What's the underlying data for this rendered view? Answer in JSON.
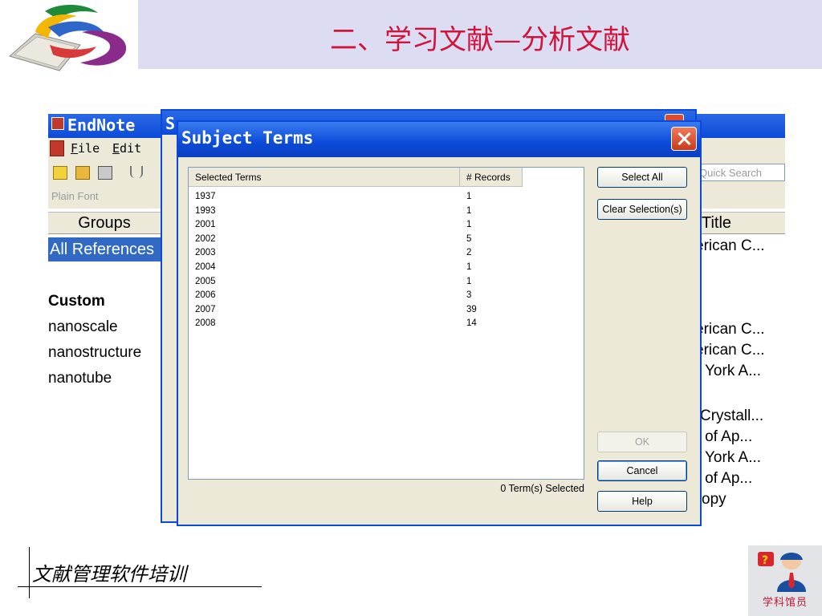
{
  "slide": {
    "title": "二、学习文献—分析文献",
    "footer_text": "文献管理软件培训",
    "badge_text": "学科馆员"
  },
  "endnote_window": {
    "title": "EndNote",
    "menu": [
      "File",
      "Edit"
    ],
    "font_selector": "Plain Font",
    "quick_search_placeholder": "Quick Search",
    "groups_header": "Groups",
    "selected_group": "All References",
    "custom_group_header": "Custom",
    "custom_groups": [
      "nanoscale",
      "nanostructure",
      "nanotube"
    ],
    "title_column_header": "Title",
    "visible_titles": [
      "erican C...",
      "erican C...",
      "erican C...",
      "York A...",
      "Crystall...",
      "al of Ap...",
      "York A...",
      "al of Ap...",
      "opy"
    ]
  },
  "background_dialog": {
    "title_letter": "S"
  },
  "dialog": {
    "title": "Subject Terms",
    "columns": [
      "Selected Terms",
      "# Records"
    ],
    "rows": [
      {
        "term": "1937",
        "records": "1"
      },
      {
        "term": "1993",
        "records": "1"
      },
      {
        "term": "2001",
        "records": "1"
      },
      {
        "term": "2002",
        "records": "5"
      },
      {
        "term": "2003",
        "records": "2"
      },
      {
        "term": "2004",
        "records": "1"
      },
      {
        "term": "2005",
        "records": "1"
      },
      {
        "term": "2006",
        "records": "3"
      },
      {
        "term": "2007",
        "records": "39"
      },
      {
        "term": "2008",
        "records": "14"
      }
    ],
    "status": "0 Term(s) Selected",
    "buttons": {
      "select_all": "Select All",
      "clear_selection": "Clear Selection(s)",
      "ok": "OK",
      "cancel": "Cancel",
      "help": "Help"
    }
  },
  "colors": {
    "title_red": "#d0143c",
    "header_band": "#dcdcf2",
    "xp_blue": "#0b4ad8",
    "dialog_bg": "#ece9d8",
    "selection_blue": "#316ac5"
  }
}
